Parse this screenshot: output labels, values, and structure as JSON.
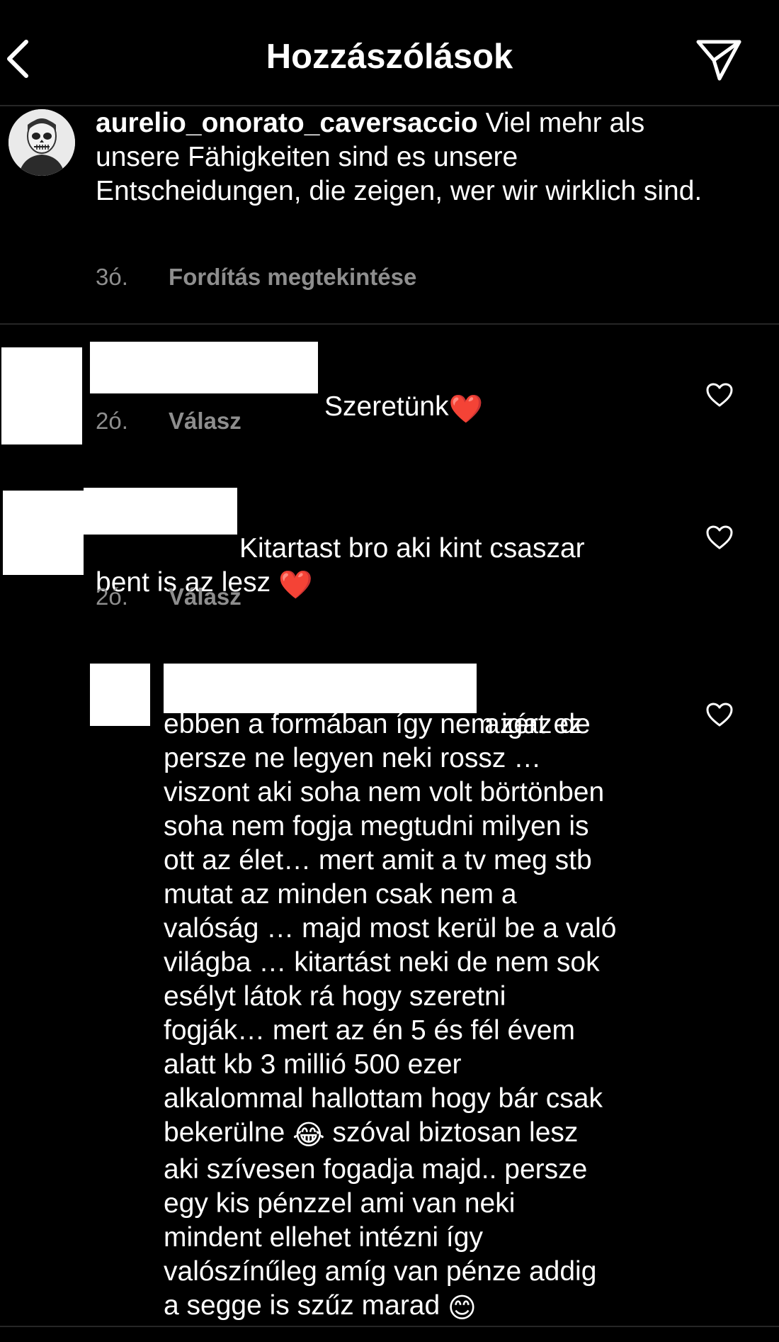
{
  "header": {
    "title": "Hozzászólások"
  },
  "caption": {
    "username": "aurelio_onorato_caversaccio",
    "text": " Viel mehr als unsere Fähigkeiten sind es unsere Entscheidungen, die zeigen, wer wir wirklich sind.",
    "time": "3ó.",
    "translate_label": "Fordítás megtekintése"
  },
  "comments": [
    {
      "text": "Szeretünk",
      "emoji": "❤️",
      "time": "2ó.",
      "reply_label": "Válasz"
    },
    {
      "text_line1": "Kitartast bro aki kint csaszar",
      "text_line2": "bent is az lesz ",
      "emoji": "❤️",
      "time": "2ó.",
      "reply_label": "Válasz"
    }
  ],
  "reply": {
    "line1": "azért ez",
    "lines_a": "ebben a formában így nem igaz de\npersze ne legyen neki rossz …\nviszont aki soha nem volt börtönben\nsoha nem fogja megtudni milyen is\nott az élet… mert amit a tv meg stb\nmutat az minden csak nem a\nvalóság … majd most kerül be a való\nvilágba … kitartást neki de nem sok\nesélyt látok rá hogy szeretni\nfogják… mert az én 5 és fél évem\nalatt kb 3 millió 500 ezer\nalkalommal hallottam hogy bár csak",
    "line_b_pre": "bekerülne ",
    "emoji_laugh": "😂",
    "line_b_post": " szóval biztosan lesz",
    "lines_c": "aki szívesen fogadja majd.. persze\negy kis pénzzel ami van neki\nmindent ellehet intézni így\nvalószínűleg amíg van pénze addig",
    "line_d_pre": "a segge is szűz marad ",
    "emoji_smile": "😊"
  },
  "icons": {
    "back": "chevron-left-icon",
    "send": "paper-plane-icon",
    "like": "heart-outline-icon"
  }
}
